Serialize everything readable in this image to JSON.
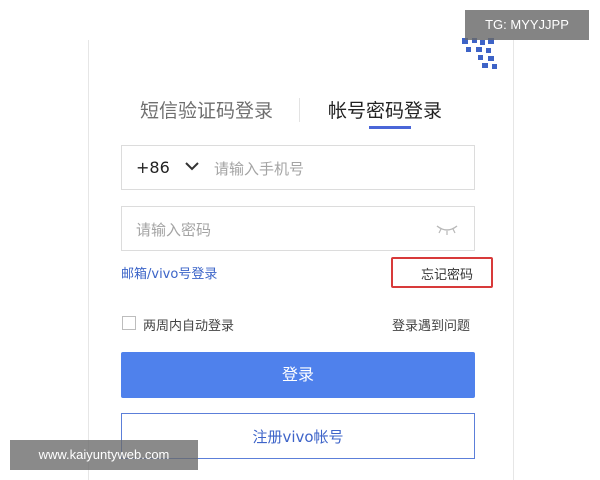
{
  "tabs": {
    "sms_login": "短信验证码登录",
    "password_login": "帐号密码登录"
  },
  "phone": {
    "country_code": "+86",
    "placeholder": "请输入手机号",
    "value": ""
  },
  "password": {
    "placeholder": "请输入密码",
    "value": ""
  },
  "links": {
    "email_login": "邮箱/vivo号登录",
    "forgot_password": "忘记密码",
    "trouble": "登录遇到问题"
  },
  "remember": {
    "label": "两周内自动登录",
    "checked": false
  },
  "buttons": {
    "login": "登录",
    "register": "注册vivo帐号"
  },
  "watermarks": {
    "top": "TG: MYYJJPP",
    "bottom": "www.kaiyuntyweb.com"
  },
  "colors": {
    "accent": "#4f81ec",
    "link": "#3b64c8",
    "highlight": "#d83a3a"
  },
  "icons": {
    "qr": "qr-code-icon",
    "chevron": "chevron-down-icon",
    "eye": "eye-closed-icon"
  }
}
